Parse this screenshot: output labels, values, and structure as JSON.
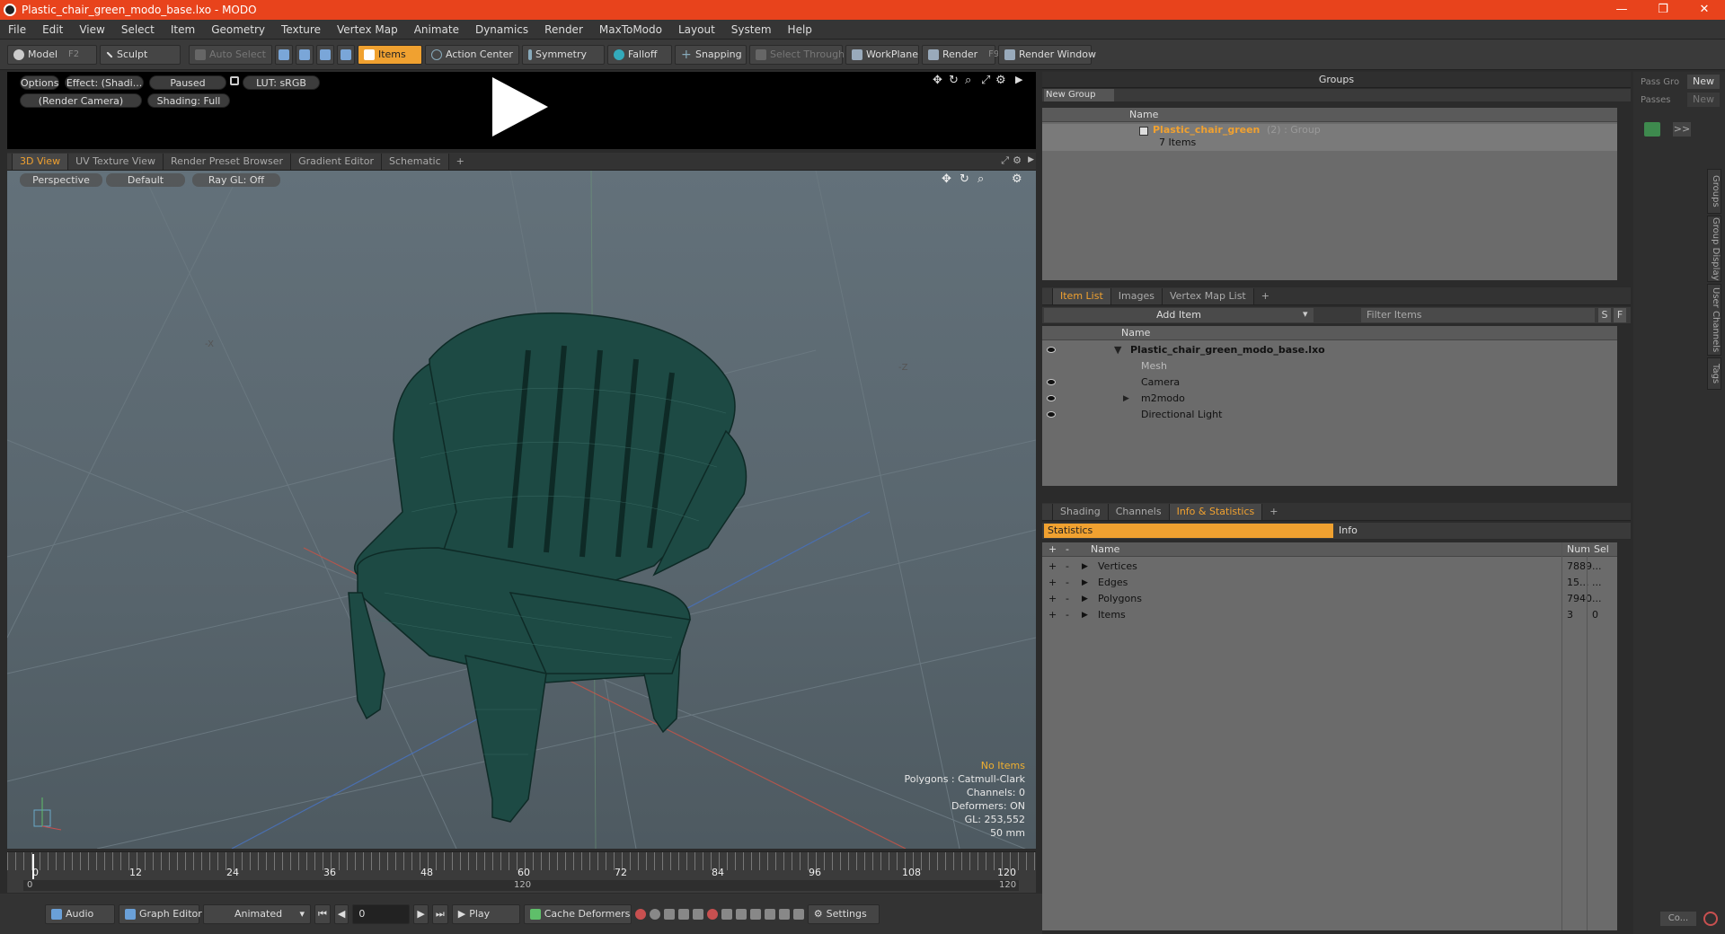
{
  "window": {
    "title": "Plastic_chair_green_modo_base.lxo - MODO",
    "minimize": "—",
    "maximize": "❐",
    "close": "✕"
  },
  "menu": [
    "File",
    "Edit",
    "View",
    "Select",
    "Item",
    "Geometry",
    "Texture",
    "Vertex Map",
    "Animate",
    "Dynamics",
    "Render",
    "MaxToModo",
    "Layout",
    "System",
    "Help"
  ],
  "toolbar": {
    "model": "Model",
    "model_hotkey": "F2",
    "sculpt": "Sculpt",
    "auto_select": "Auto Select",
    "items": "Items",
    "action_center": "Action Center",
    "symmetry": "Symmetry",
    "falloff": "Falloff",
    "snapping": "Snapping",
    "select_through": "Select Through",
    "workplane": "WorkPlane",
    "render": "Render",
    "render_hotkey": "F9",
    "render_window": "Render Window"
  },
  "preview": {
    "options": "Options",
    "effect": "Effect: (Shadi...",
    "paused": "Paused",
    "lut": "LUT: sRGB",
    "camera": "(Render Camera)",
    "shading": "Shading: Full"
  },
  "view_tabs": [
    "3D View",
    "UV Texture View",
    "Render Preset Browser",
    "Gradient Editor",
    "Schematic",
    "+"
  ],
  "viewport": {
    "perspective": "Perspective",
    "default": "Default",
    "raygl": "Ray GL: Off",
    "axis_x": "-X",
    "axis_z": "-Z",
    "stats": [
      "No Items",
      "Polygons : Catmull-Clark",
      "Channels: 0",
      "Deformers: ON",
      "GL: 253,552",
      "50 mm"
    ]
  },
  "timeline": {
    "ticks": [
      "0",
      "12",
      "24",
      "36",
      "48",
      "60",
      "72",
      "84",
      "96",
      "108",
      "120"
    ],
    "range_start": "0",
    "range_mid": "120",
    "range_end": "120"
  },
  "bottombar": {
    "audio": "Audio",
    "graph_editor": "Graph Editor",
    "animated": "Animated",
    "frame": "0",
    "play": "Play",
    "cache": "Cache Deformers",
    "settings": "Settings"
  },
  "groups": {
    "title": "Groups",
    "new_group": "New Group",
    "col_name": "Name",
    "item_name": "Plastic_chair_green",
    "item_suffix": "(2) : Group",
    "item_count": "7 Items"
  },
  "pass": {
    "label1": "Pass Gro",
    "new1": "New",
    "label2": "Passes",
    "new2": "New",
    "expand": ">>"
  },
  "itemlist": {
    "tabs": [
      "Item List",
      "Images",
      "Vertex Map List",
      "+"
    ],
    "add_item": "Add Item",
    "filter": "Filter Items",
    "s": "S",
    "f": "F",
    "col_name": "Name",
    "items": [
      {
        "name": "Plastic_chair_green_modo_base.lxo",
        "indent": 0
      },
      {
        "name": "Mesh",
        "indent": 1
      },
      {
        "name": "Camera",
        "indent": 1
      },
      {
        "name": "m2modo",
        "indent": 1
      },
      {
        "name": "Directional Light",
        "indent": 1
      }
    ]
  },
  "stats": {
    "tabs": [
      "Shading",
      "Channels",
      "Info & Statistics",
      "+"
    ],
    "statistics": "Statistics",
    "info": "Info",
    "col_name": "Name",
    "col_num": "Num",
    "col_sel": "Sel",
    "rows": [
      {
        "name": "Vertices",
        "num": "7889",
        "sel": "..."
      },
      {
        "name": "Edges",
        "num": "15...",
        "sel": "..."
      },
      {
        "name": "Polygons",
        "num": "7940",
        "sel": "..."
      },
      {
        "name": "Items",
        "num": "3",
        "sel": "0"
      }
    ]
  },
  "side_tabs": [
    "Groups",
    "Group Display",
    "User Channels",
    "Tags"
  ],
  "corner": {
    "co": "Co..."
  }
}
